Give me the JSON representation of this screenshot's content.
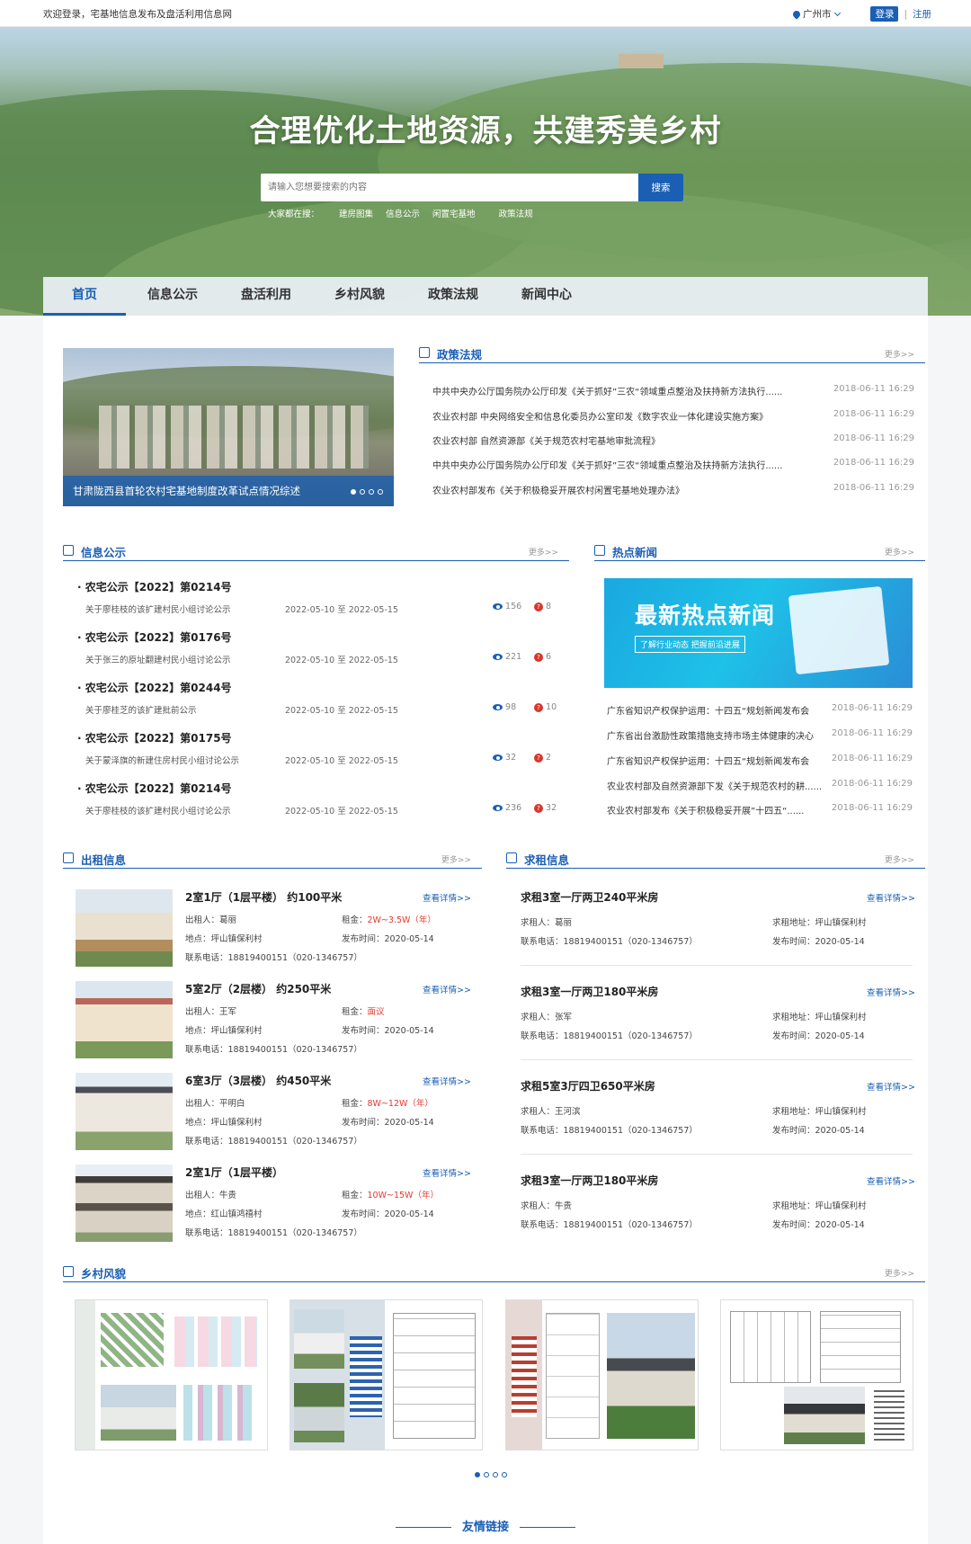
{
  "topbar": {
    "welcome": "欢迎登录，宅基地信息发布及盘活利用信息网",
    "city": "广州市",
    "login": "登录",
    "sep": "|",
    "register": "注册"
  },
  "hero": {
    "headline": "合理优化土地资源，共建秀美乡村",
    "search_placeholder": "请输入您想要搜索的内容",
    "search_button": "搜索",
    "hot_label": "大家都在搜：",
    "hot_items": [
      "建房图集",
      "信息公示",
      "闲置宅基地",
      "政策法规"
    ]
  },
  "nav": [
    "首页",
    "信息公示",
    "盘活利用",
    "乡村风貌",
    "政策法规",
    "新闻中心"
  ],
  "banner_caption": "甘肃陇西县首轮农村宅基地制度改革试点情况综述",
  "policy": {
    "title": "政策法规",
    "more": "更多>>",
    "items": [
      {
        "text": "中共中央办公厅国务院办公厅印发《关于抓好”三农“领域重点整治及扶持新方法执行......",
        "date": "2018-06-11 16:29"
      },
      {
        "text": "农业农村部 中央网络安全和信息化委员办公室印发《数字农业一体化建设实施方案》",
        "date": "2018-06-11 16:29"
      },
      {
        "text": "农业农村部 自然资源部《关于规范农村宅基地审批流程》",
        "date": "2018-06-11 16:29"
      },
      {
        "text": "中共中央办公厅国务院办公厅印发《关于抓好”三农“领域重点整治及扶持新方法执行......",
        "date": "2018-06-11 16:29"
      },
      {
        "text": "农业农村部发布《关于积极稳妥开展农村闲置宅基地处理办法》",
        "date": "2018-06-11 16:29"
      }
    ]
  },
  "notices": {
    "title": "信息公示",
    "more": "更多>>",
    "items": [
      {
        "title": "农宅公示【2022】第0214号",
        "sub": "关于廖桂枝的该扩建村民小组讨论公示",
        "date": "2022-05-10 至 2022-05-15",
        "views": "156",
        "asks": "8"
      },
      {
        "title": "农宅公示【2022】第0176号",
        "sub": "关于张三的原址翻建村民小组讨论公示",
        "date": "2022-05-10 至 2022-05-15",
        "views": "221",
        "asks": "6"
      },
      {
        "title": "农宅公示【2022】第0244号",
        "sub": "关于廖桂芝的该扩建批前公示",
        "date": "2022-05-10 至 2022-05-15",
        "views": "98",
        "asks": "10"
      },
      {
        "title": "农宅公示【2022】第0175号",
        "sub": "关于蒙泽旗的新建住房村民小组讨论公示",
        "date": "2022-05-10 至 2022-05-15",
        "views": "32",
        "asks": "2"
      },
      {
        "title": "农宅公示【2022】第0214号",
        "sub": "关于廖桂枝的该扩建村民小组讨论公示",
        "date": "2022-05-10 至 2022-05-15",
        "views": "236",
        "asks": "32"
      }
    ]
  },
  "hotnews": {
    "title": "热点新闻",
    "more": "更多>>",
    "img_big": "最新热点新闻",
    "img_small": "了解行业动态  把握前沿进展",
    "items": [
      {
        "text": "广东省知识产权保护运用：十四五“规划新闻发布会",
        "date": "2018-06-11 16:29"
      },
      {
        "text": "广东省出台激励性政策措施支持市场主体健康的决心",
        "date": "2018-06-11 16:29"
      },
      {
        "text": "广东省知识产权保护运用：十四五“规划新闻发布会",
        "date": "2018-06-11 16:29"
      },
      {
        "text": "农业农村部及自然资源部下发《关于规范农村的耕......",
        "date": "2018-06-11 16:29"
      },
      {
        "text": "农业农村部发布《关于积极稳妥开展”十四五“......",
        "date": "2018-06-11 16:29"
      }
    ]
  },
  "rent": {
    "title": "出租信息",
    "more": "更多>>",
    "detail": "查看详情>>",
    "labels": {
      "owner": "出租人：",
      "rent": "租金：",
      "place": "地点：",
      "time": "发布时间：",
      "phone": "联系电话："
    },
    "items": [
      {
        "title": "2室1厅（1层平楼） 约100平米",
        "owner": "葛丽",
        "rent": "2W~3.5W（年）",
        "place": "坪山镇保利村",
        "time": "2020-05-14",
        "phone": "18819400151（020-1346757）"
      },
      {
        "title": "5室2厅（2层楼） 约250平米",
        "owner": "王军",
        "rent": "面议",
        "place": "坪山镇保利村",
        "time": "2020-05-14",
        "phone": "18819400151（020-1346757）"
      },
      {
        "title": "6室3厅（3层楼） 约450平米",
        "owner": "平明白",
        "rent": "8W~12W（年）",
        "place": "坪山镇保利村",
        "time": "2020-05-14",
        "phone": "18819400151（020-1346757）"
      },
      {
        "title": "2室1厅（1层平楼）",
        "owner": "牛贵",
        "rent": "10W~15W（年）",
        "place": "红山镇鸿禧村",
        "time": "2020-05-14",
        "phone": "18819400151（020-1346757）"
      }
    ]
  },
  "seek": {
    "title": "求租信息",
    "more": "更多>>",
    "detail": "查看详情>>",
    "labels": {
      "renter": "求租人：",
      "addr": "求租地址：",
      "phone": "联系电话：",
      "time": "发布时间："
    },
    "items": [
      {
        "title": "求租3室一厅两卫240平米房",
        "renter": "葛丽",
        "addr": "坪山镇保利村",
        "phone": "18819400151（020-1346757）",
        "time": "2020-05-14"
      },
      {
        "title": "求租3室一厅两卫180平米房",
        "renter": "张军",
        "addr": "坪山镇保利村",
        "phone": "18819400151（020-1346757）",
        "time": "2020-05-14"
      },
      {
        "title": "求租5室3厅四卫650平米房",
        "renter": "王河滨",
        "addr": "坪山镇保利村",
        "phone": "18819400151（020-1346757）",
        "time": "2020-05-14"
      },
      {
        "title": "求租3室一厅两卫180平米房",
        "renter": "牛贵",
        "addr": "坪山镇保利村",
        "phone": "18819400151（020-1346757）",
        "time": "2020-05-14"
      }
    ]
  },
  "village": {
    "title": "乡村风貌",
    "more": "更多>>"
  },
  "friend_links": "友情链接",
  "colors": {
    "primary": "#1a5fb4",
    "red": "#e23b2e"
  }
}
